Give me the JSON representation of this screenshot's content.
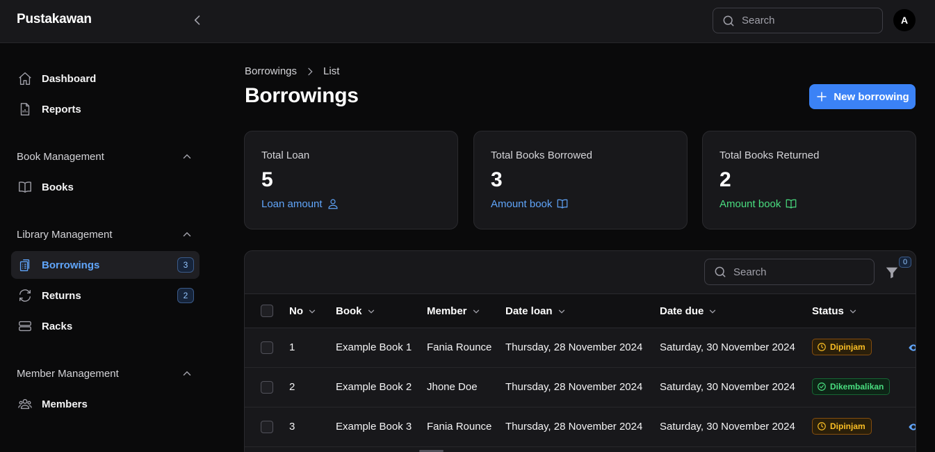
{
  "app": {
    "brand": "Pustakawan",
    "avatar_initial": "A"
  },
  "topbar": {
    "search_placeholder": "Search"
  },
  "sidebar": {
    "items": [
      {
        "label": "Dashboard",
        "icon": "home-icon"
      },
      {
        "label": "Reports",
        "icon": "document-chart-icon"
      }
    ],
    "groups": [
      {
        "title": "Book Management",
        "items": [
          {
            "label": "Books",
            "icon": "book-open-icon"
          }
        ]
      },
      {
        "title": "Library Management",
        "items": [
          {
            "label": "Borrowings",
            "icon": "clipboard-document-list-icon",
            "badge": "3",
            "active": true
          },
          {
            "label": "Returns",
            "icon": "arrow-path-icon",
            "badge": "2"
          },
          {
            "label": "Racks",
            "icon": "server-stack-icon"
          }
        ]
      },
      {
        "title": "Member Management",
        "items": [
          {
            "label": "Members",
            "icon": "user-group-icon"
          }
        ]
      }
    ]
  },
  "breadcrumb": {
    "first": "Borrowings",
    "second": "List"
  },
  "page": {
    "title": "Borrowings",
    "new_button_label": "New borrowing"
  },
  "stats": [
    {
      "label": "Total Loan",
      "value": "5",
      "desc": "Loan amount",
      "icon": "user-icon",
      "color": "#60a5fa"
    },
    {
      "label": "Total Books Borrowed",
      "value": "3",
      "desc": "Amount book",
      "icon": "book-open-icon",
      "color": "#60a5fa"
    },
    {
      "label": "Total Books Returned",
      "value": "2",
      "desc": "Amount book",
      "icon": "book-open-icon",
      "color": "#4ade80"
    }
  ],
  "table": {
    "search_placeholder": "Search",
    "filter_count": "0",
    "columns": [
      "No",
      "Book",
      "Member",
      "Date loan",
      "Date due",
      "Status"
    ],
    "rows": [
      {
        "no": "1",
        "book": "Example Book 1",
        "member": "Fania Rounce",
        "date_loan": "Thursday, 28 November 2024",
        "date_due": "Saturday, 30 November 2024",
        "status": "Dipinjam",
        "status_type": "loan"
      },
      {
        "no": "2",
        "book": "Example Book 2",
        "member": "Jhone Doe",
        "date_loan": "Thursday, 28 November 2024",
        "date_due": "Saturday, 30 November 2024",
        "status": "Dikembalikan",
        "status_type": "returned"
      },
      {
        "no": "3",
        "book": "Example Book 3",
        "member": "Fania Rounce",
        "date_loan": "Thursday, 28 November 2024",
        "date_due": "Saturday, 30 November 2024",
        "status": "Dipinjam",
        "status_type": "loan"
      }
    ]
  }
}
